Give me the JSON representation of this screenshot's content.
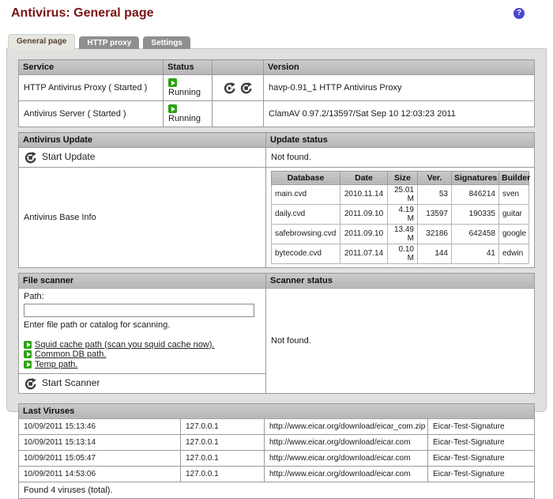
{
  "page": {
    "title": "Antivirus: General page",
    "help_glyph": "?"
  },
  "tabs": [
    {
      "label": "General page",
      "active": true
    },
    {
      "label": "HTTP proxy",
      "active": false
    },
    {
      "label": "Settings",
      "active": false
    }
  ],
  "services": {
    "headers": {
      "service": "Service",
      "status": "Status",
      "version": "Version"
    },
    "rows": [
      {
        "name": "HTTP Antivirus Proxy ( Started )",
        "status": "Running",
        "version": "havp-0.91_1 HTTP Antivirus Proxy"
      },
      {
        "name": "Antivirus Server ( Started )",
        "status": "Running",
        "version": "ClamAV 0.97.2/13597/Sat Sep 10 12:03:23 2011"
      }
    ]
  },
  "update": {
    "header": "Antivirus Update",
    "status_header": "Update status",
    "start_update_label": "Start Update",
    "status_text": "Not found.",
    "base_info_label": "Antivirus Base Info",
    "db_table": {
      "headers": [
        "Database",
        "Date",
        "Size",
        "Ver.",
        "Signatures",
        "Builder"
      ],
      "rows": [
        [
          "main.cvd",
          "2010.11.14",
          "25.01 M",
          "53",
          "846214",
          "sven"
        ],
        [
          "daily.cvd",
          "2011.09.10",
          "4.19 M",
          "13597",
          "190335",
          "guitar"
        ],
        [
          "safebrowsing.cvd",
          "2011.09.10",
          "13.49 M",
          "32186",
          "642458",
          "google"
        ],
        [
          "bytecode.cvd",
          "2011.07.14",
          "0.10 M",
          "144",
          "41",
          "edwin"
        ]
      ]
    }
  },
  "scanner": {
    "header": "File scanner",
    "status_header": "Scanner status",
    "path_label": "Path:",
    "path_value": "",
    "path_hint": "Enter file path or catalog for scanning.",
    "links": [
      "Squid cache path (scan you squid cache now).",
      "Common DB path.",
      "Temp path."
    ],
    "start_scanner_label": "Start Scanner",
    "status_text": "Not found."
  },
  "last_viruses": {
    "header": "Last Viruses",
    "rows": [
      {
        "time": "10/09/2011 15:13:46",
        "ip": "127.0.0.1",
        "url": "http://www.eicar.org/download/eicar_com.zip",
        "signature": "Eicar-Test-Signature"
      },
      {
        "time": "10/09/2011 15:13:14",
        "ip": "127.0.0.1",
        "url": "http://www.eicar.org/download/eicar.com",
        "signature": "Eicar-Test-Signature"
      },
      {
        "time": "10/09/2011 15:05:47",
        "ip": "127.0.0.1",
        "url": "http://www.eicar.org/download/eicar.com",
        "signature": "Eicar-Test-Signature"
      },
      {
        "time": "10/09/2011 14:53:06",
        "ip": "127.0.0.1",
        "url": "http://www.eicar.org/download/eicar.com",
        "signature": "Eicar-Test-Signature"
      }
    ],
    "footer": "Found 4 viruses (total)."
  },
  "colors": {
    "title": "#7A1416",
    "accent_green": "#2CA312",
    "help_blue": "#4A49CF",
    "header_gray": "#BFBFBF"
  }
}
